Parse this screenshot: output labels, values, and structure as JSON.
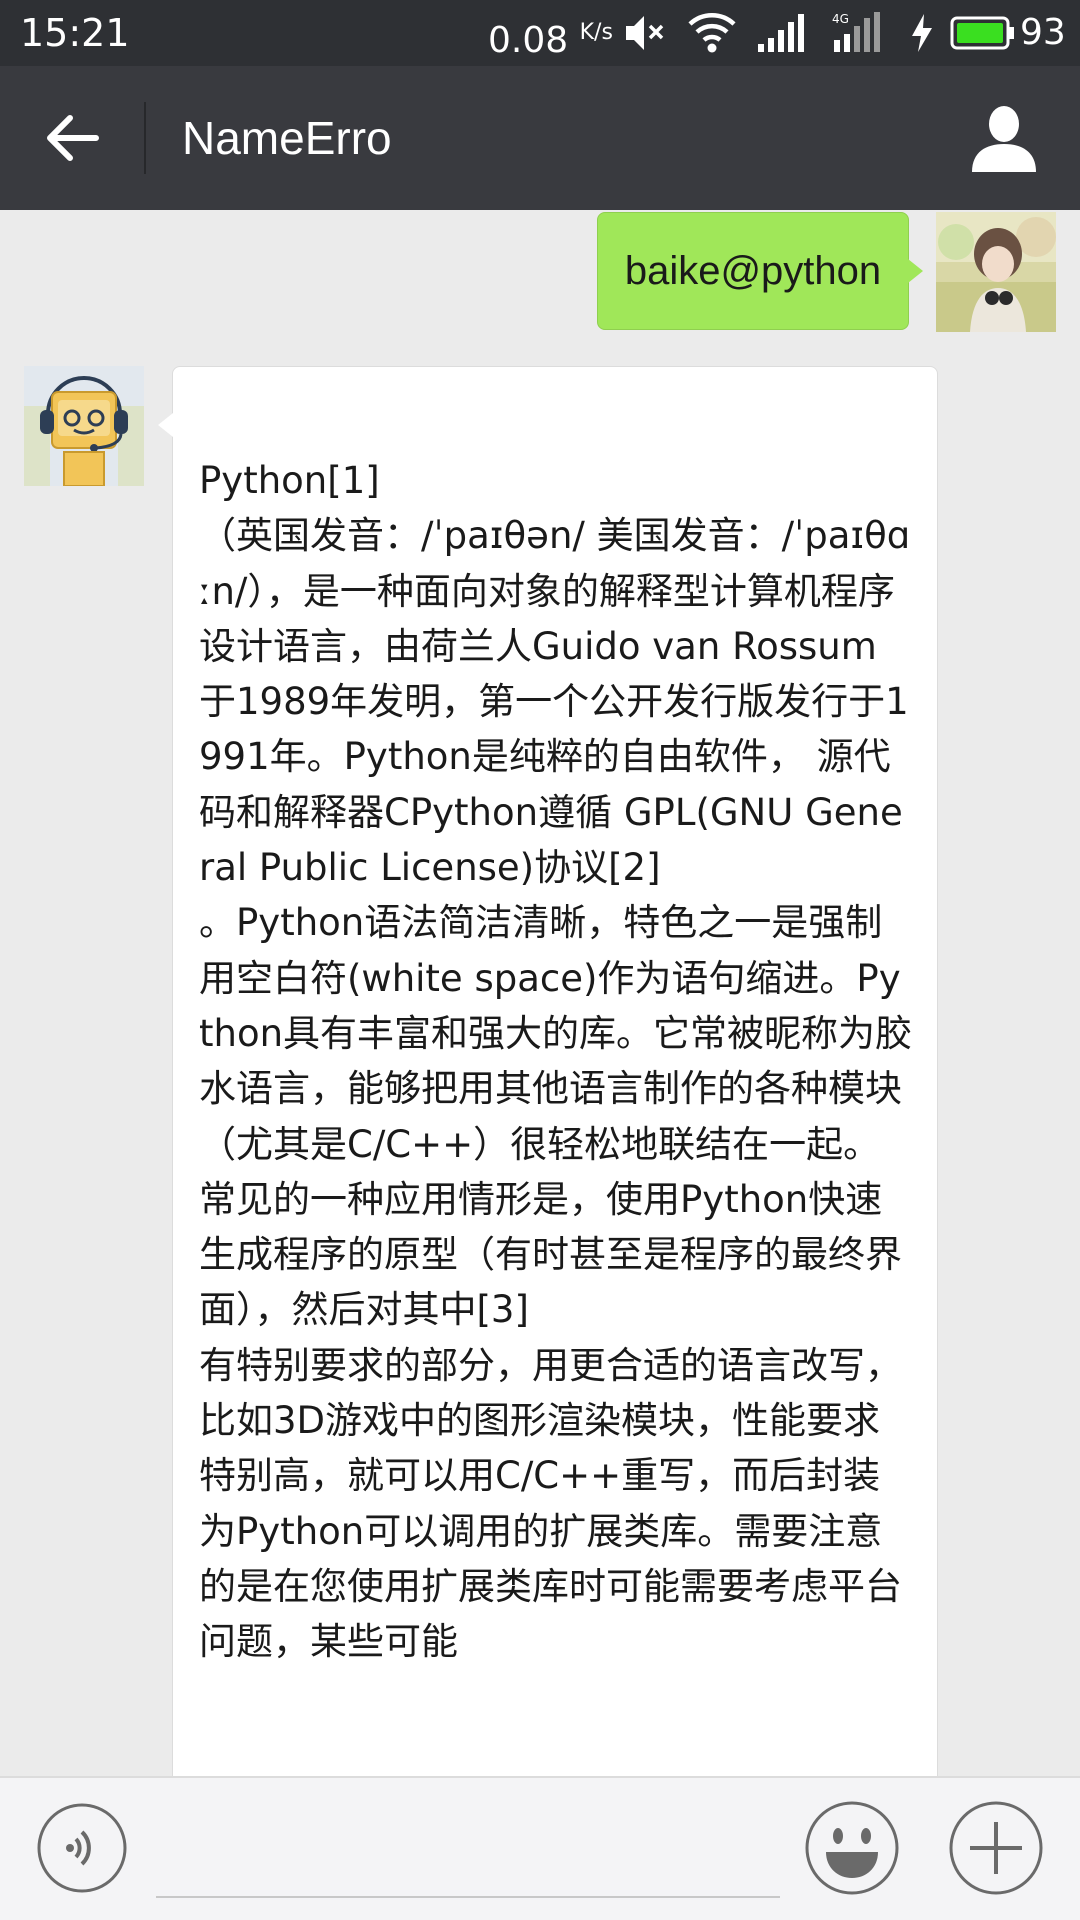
{
  "status_bar": {
    "time": "15:21",
    "net_speed": "0.08",
    "net_speed_unit": "K/s",
    "network_type": "4G",
    "battery_level": "93",
    "icons": [
      "mute-icon",
      "wifi-icon",
      "signal-icon",
      "4g-signal-icon",
      "charging-icon",
      "battery-icon"
    ]
  },
  "header": {
    "title": "NameErro",
    "back_icon": "back-arrow-icon",
    "profile_icon": "person-icon"
  },
  "messages": [
    {
      "direction": "sent",
      "text": "baike@python",
      "avatar": "user-avatar"
    },
    {
      "direction": "received",
      "avatar": "robot-avatar",
      "text": "Python[1]\n（英国发音：/ˈpaɪθən/ 美国发音：/ˈpaɪθɑːn/），是一种面向对象的解释型计算机程序设计语言，由荷兰人Guido van Rossum于1989年发明，第一个公开发行版发行于1991年。Python是纯粹的自由软件， 源代码和解释器CPython遵循 GPL(GNU General Public License)协议[2]\n。Python语法简洁清晰，特色之一是强制用空白符(white space)作为语句缩进。Python具有丰富和强大的库。它常被昵称为胶水语言，能够把用其他语言制作的各种模块（尤其是C/C++）很轻松地联结在一起。常见的一种应用情形是，使用Python快速生成程序的原型（有时甚至是程序的最终界面），然后对其中[3]\n有特别要求的部分，用更合适的语言改写，比如3D游戏中的图形渲染模块，性能要求特别高，就可以用C/C++重写，而后封装为Python可以调用的扩展类库。需要注意的是在您使用扩展类库时可能需要考虑平台问题，某些可能"
    }
  ],
  "input_bar": {
    "voice_icon": "voice-icon",
    "input_value": "",
    "emoji_icon": "emoji-icon",
    "more_icon": "plus-icon"
  },
  "colors": {
    "status_bar_bg": "#2e3034",
    "title_bar_bg": "#393a3f",
    "chat_bg": "#ebebeb",
    "sent_bubble": "#a0e759",
    "received_bubble": "#ffffff",
    "input_bar_bg": "#f4f4f6",
    "battery_fill": "#3adf20"
  }
}
